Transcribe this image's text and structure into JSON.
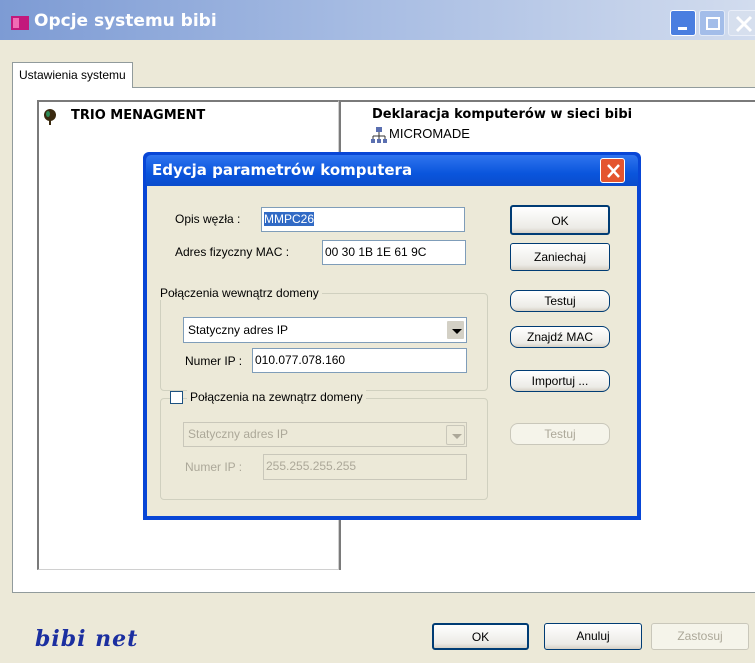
{
  "window": {
    "title": "Opcje systemu bibi"
  },
  "tab": {
    "label": "Ustawienia systemu"
  },
  "left_tree": {
    "root_label": "TRIO MENAGMENT"
  },
  "right_tree": {
    "title": "Deklaracja komputerów w sieci bibi",
    "items": [
      "MICROMADE"
    ]
  },
  "footer": {
    "ok": "OK",
    "cancel": "Anuluj",
    "apply": "Zastosuj",
    "brand": "bibi net"
  },
  "dialog": {
    "title": "Edycja parametrów komputera",
    "node_desc_label": "Opis węzła :",
    "node_desc_value": "MMPC26",
    "mac_label": "Adres fizyczny MAC :",
    "mac_value": "00 30 1B 1E 61 9C",
    "ok": "OK",
    "cancel": "Zaniechaj",
    "inside": {
      "group_label": "Połączenia wewnątrz domeny",
      "mode": "Statyczny adres IP",
      "ip_label": "Numer IP :",
      "ip_value": "010.077.078.160",
      "test": "Testuj",
      "find_mac": "Znajdź MAC",
      "import": "Importuj ..."
    },
    "outside": {
      "group_label": "Połączenia na zewnątrz domeny",
      "checked": false,
      "mode": "Statyczny adres IP",
      "ip_label": "Numer IP :",
      "ip_value": "255.255.255.255",
      "test": "Testuj"
    }
  },
  "colors": {
    "titlebar_start": "#7d9bd4",
    "dialog_titlebar": "#0a55dc",
    "close_red": "#e4552f",
    "face": "#ece9d8",
    "brand": "#1b2fa0"
  }
}
